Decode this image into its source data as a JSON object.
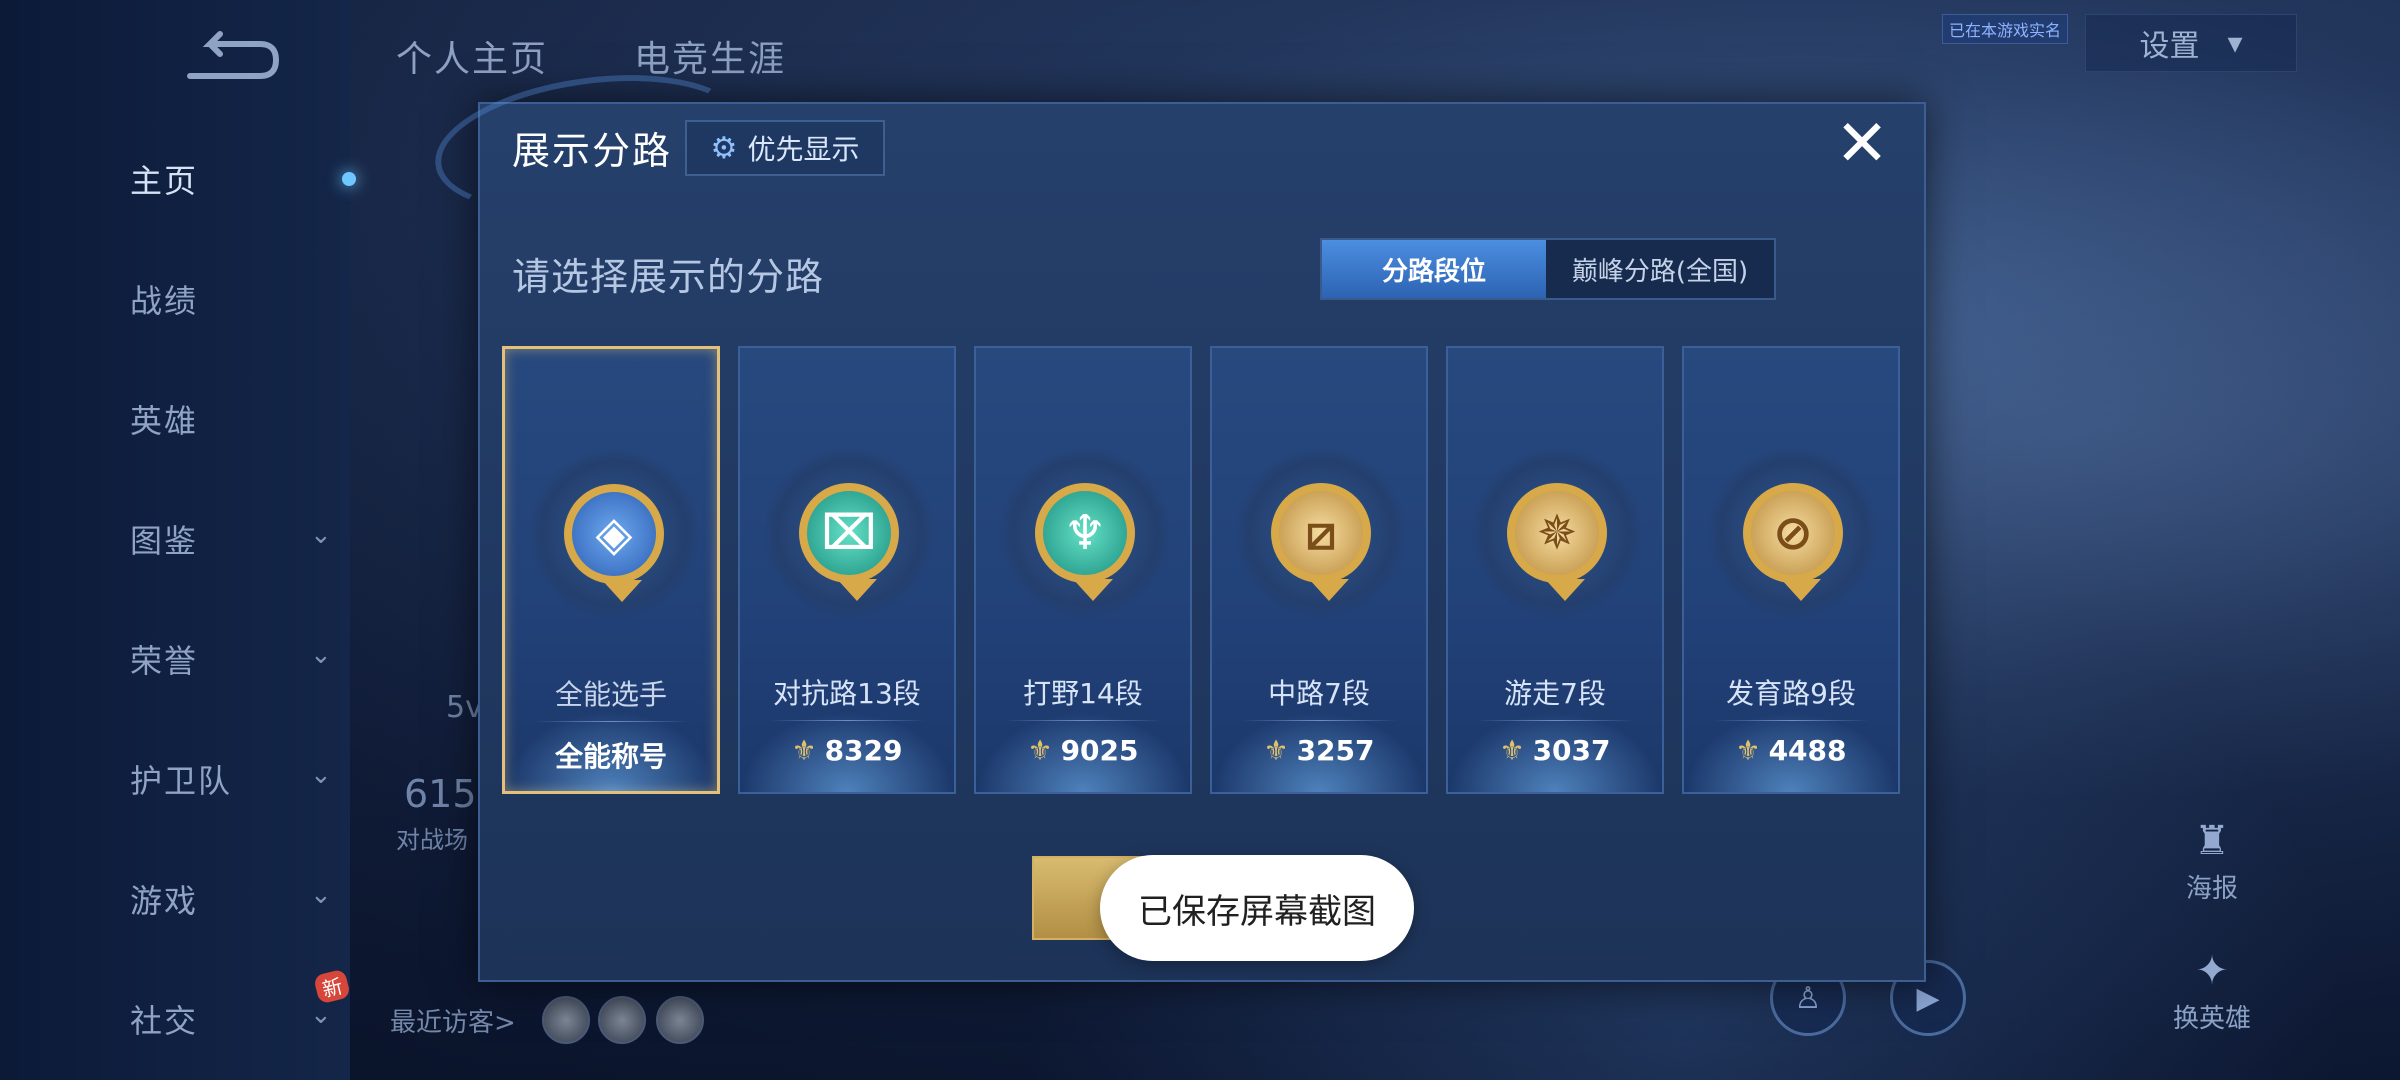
{
  "background": {
    "tabs": [
      "个人主页",
      "电竞生涯"
    ],
    "settings_label": "设置",
    "verified_label": "已在本游戏实名",
    "nav": [
      {
        "label": "主页",
        "has_chevron": false,
        "active": true
      },
      {
        "label": "战绩",
        "has_chevron": false,
        "active": false
      },
      {
        "label": "英雄",
        "has_chevron": false,
        "active": false
      },
      {
        "label": "图鉴",
        "has_chevron": true,
        "active": false
      },
      {
        "label": "荣誉",
        "has_chevron": true,
        "active": false
      },
      {
        "label": "护卫队",
        "has_chevron": true,
        "active": false
      },
      {
        "label": "游戏",
        "has_chevron": true,
        "active": false
      },
      {
        "label": "社交",
        "has_chevron": true,
        "active": false
      }
    ],
    "new_badge": "新",
    "partial_texts": {
      "left_5v": "5v",
      "left_615": "615",
      "left_stats": "对战场"
    },
    "recent_visitors_label": "最近访客>",
    "right_icons": {
      "poster": "海报",
      "change_hero": "换英雄"
    },
    "icon_names": {
      "back": "back-arrow-icon",
      "chevron": "chevron-down-icon",
      "poster": "poster-icon",
      "change_hero": "hero-swap-icon"
    }
  },
  "modal": {
    "title": "展示分路",
    "priority_button": "优先显示",
    "close_symbol": "✕",
    "subtitle": "请选择展示的分路",
    "segments": [
      "分路段位",
      "巅峰分路(全国)"
    ],
    "selected_segment": 0,
    "cards": [
      {
        "label": "全能选手",
        "score": "全能称号",
        "show_icon": false,
        "emblem_color": "blue",
        "selected": true
      },
      {
        "label": "对抗路13段",
        "score": "8329",
        "show_icon": true,
        "emblem_color": "teal",
        "selected": false
      },
      {
        "label": "打野14段",
        "score": "9025",
        "show_icon": true,
        "emblem_color": "teal",
        "selected": false
      },
      {
        "label": "中路7段",
        "score": "3257",
        "show_icon": true,
        "emblem_color": "gold",
        "selected": false
      },
      {
        "label": "游走7段",
        "score": "3037",
        "show_icon": true,
        "emblem_color": "gold",
        "selected": false
      },
      {
        "label": "发育路9段",
        "score": "4488",
        "show_icon": true,
        "emblem_color": "gold",
        "selected": false
      }
    ]
  },
  "toast": "已保存屏幕截图",
  "colors": {
    "accent_gold": "#d8a948",
    "accent_blue": "#4c8ee0",
    "selected_border": "#e3c17a"
  }
}
